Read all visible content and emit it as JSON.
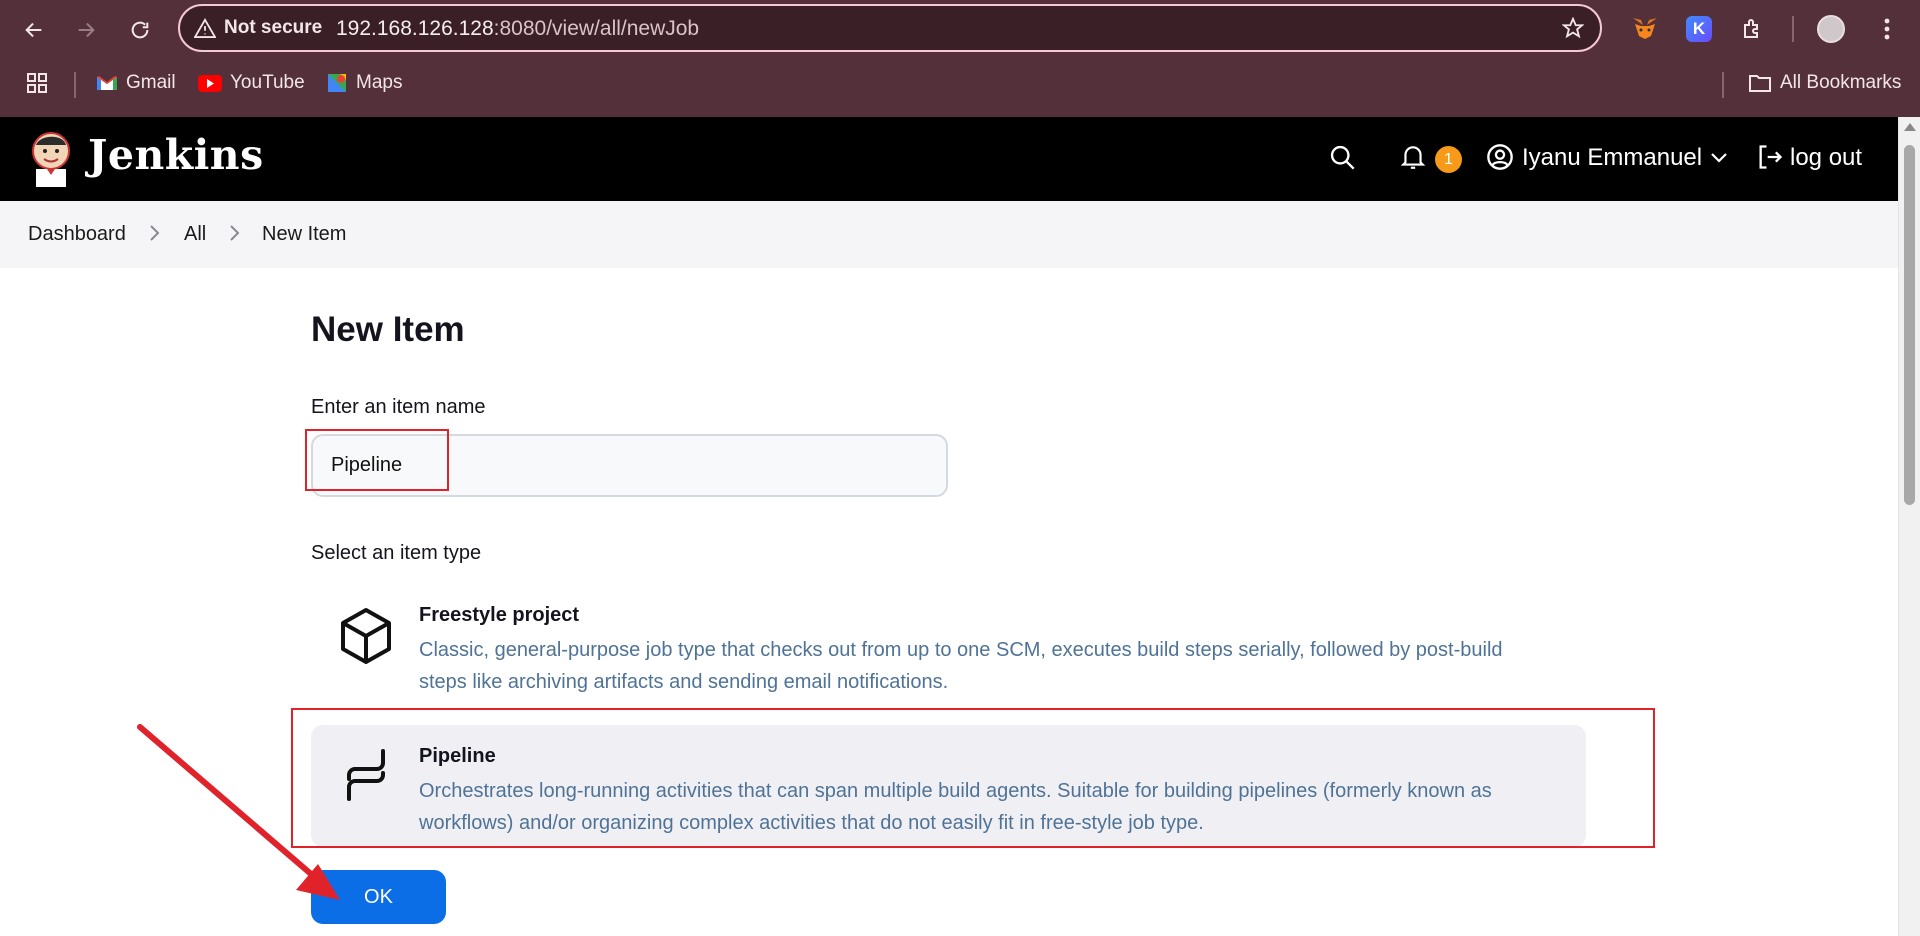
{
  "browser": {
    "security_label": "Not secure",
    "url_host": "192.168.126.128",
    "url_rest": ":8080/view/all/newJob",
    "bookmarks": [
      {
        "label": "Gmail",
        "icon": "gmail-icon"
      },
      {
        "label": "YouTube",
        "icon": "youtube-icon"
      },
      {
        "label": "Maps",
        "icon": "maps-icon"
      }
    ],
    "all_bookmarks_label": "All Bookmarks"
  },
  "header": {
    "brand": "Jenkins",
    "notification_count": "1",
    "user_name": "Iyanu Emmanuel",
    "logout_label": "log out"
  },
  "breadcrumb": [
    "Dashboard",
    "All",
    "New Item"
  ],
  "page": {
    "title": "New Item",
    "name_label": "Enter an item name",
    "name_value": "Pipeline",
    "type_label": "Select an item type",
    "item_types": [
      {
        "title": "Freestyle project",
        "description": "Classic, general-purpose job type that checks out from up to one SCM, executes build steps serially, followed by post-build steps like archiving artifacts and sending email notifications.",
        "icon": "cube-icon",
        "selected": false
      },
      {
        "title": "Pipeline",
        "description": "Orchestrates long-running activities that can span multiple build agents. Suitable for building pipelines (formerly known as workflows) and/or organizing complex activities that do not easily fit in free-style job type.",
        "icon": "pipeline-icon",
        "selected": true
      }
    ],
    "ok_label": "OK"
  },
  "colors": {
    "chrome": "#54303a",
    "accent_blue": "#0b6ee6",
    "annotation_red": "#e0232b",
    "badge_orange": "#f79a1a"
  }
}
